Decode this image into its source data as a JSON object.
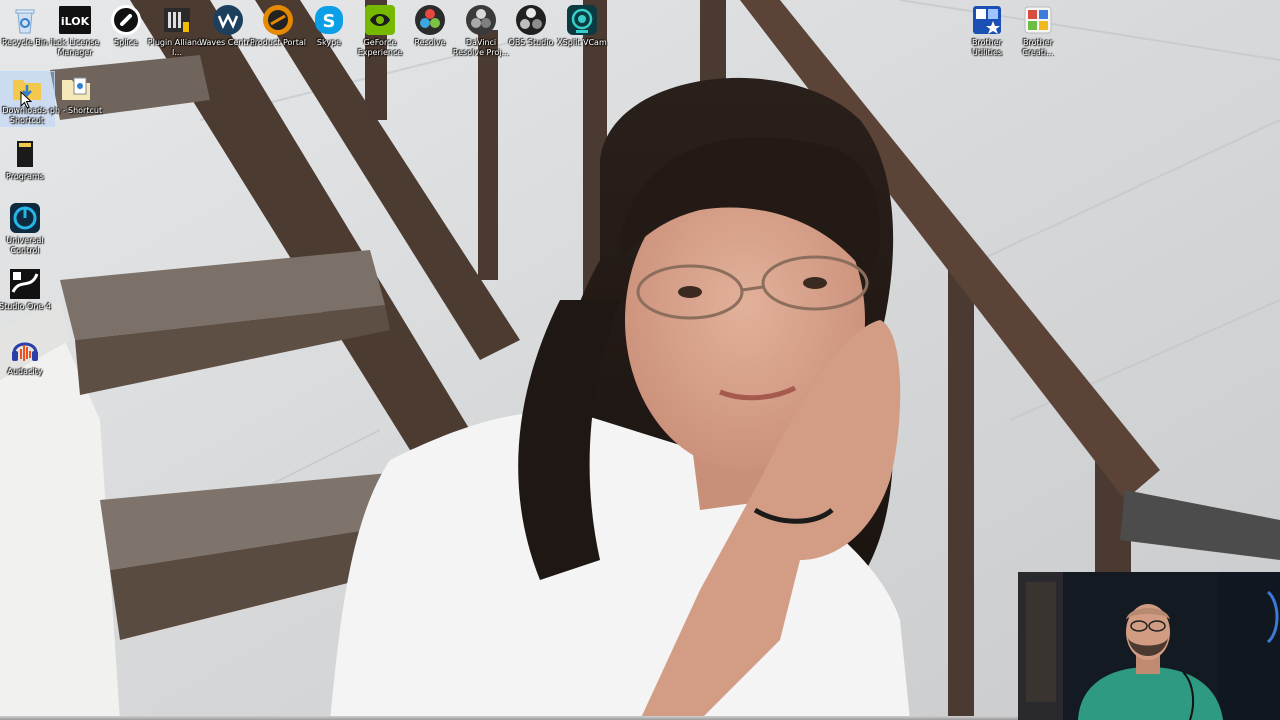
{
  "desktop": {
    "top_icons": [
      {
        "label": "Recycle Bin",
        "icon": "recycle-bin-icon",
        "color": "#9fc3e8"
      },
      {
        "label": "iLok License Manager",
        "icon": "ilok-icon",
        "color": "#111111"
      },
      {
        "label": "Splice",
        "icon": "splice-icon",
        "color": "#ffffff"
      },
      {
        "label": "Plugin Alliance I...",
        "icon": "plugin-alliance-icon",
        "color": "#2a2a2a"
      },
      {
        "label": "Waves Central",
        "icon": "waves-icon",
        "color": "#1c3f5e"
      },
      {
        "label": "Product Portal",
        "icon": "product-portal-icon",
        "color": "#e58a00"
      },
      {
        "label": "Skype",
        "icon": "skype-icon",
        "color": "#0a9fe6"
      },
      {
        "label": "GeForce Experience",
        "icon": "geforce-icon",
        "color": "#76b900"
      },
      {
        "label": "Resolve",
        "icon": "resolve-icon",
        "color": "#2b2b2b"
      },
      {
        "label": "DaVinci Resolve Proj...",
        "icon": "davinci-project-icon",
        "color": "#3a3a3a"
      },
      {
        "label": "OBS Studio",
        "icon": "obs-icon",
        "color": "#202020"
      },
      {
        "label": "XSplit VCam",
        "icon": "xsplit-vcam-icon",
        "color": "#0b6b73"
      }
    ],
    "right_icons": [
      {
        "label": "Brother Utilities",
        "icon": "brother-utilities-icon",
        "color": "#1a4fb3"
      },
      {
        "label": "Brother Creati...",
        "icon": "brother-creative-icon",
        "color": "#d94b3c"
      }
    ],
    "left_icons": [
      {
        "label": "Downloads - Shortcut",
        "icon": "downloads-folder-icon",
        "color": "#f2c94c",
        "selected": true
      },
      {
        "label": "ph - Shortcut",
        "icon": "document-shortcut-icon",
        "color": "#f4e7b8",
        "selected": false
      },
      {
        "label": "Programs",
        "icon": "programs-folder-icon",
        "color": "#1a1a1a",
        "selected": false
      },
      {
        "label": "Universal Control",
        "icon": "universal-control-icon",
        "color": "#0d5e87",
        "selected": false
      },
      {
        "label": "Studio One 4",
        "icon": "studio-one-icon",
        "color": "#111111",
        "selected": false
      },
      {
        "label": "Audacity",
        "icon": "audacity-icon",
        "color": "#f0a81c",
        "selected": false
      }
    ]
  },
  "wallpaper": {
    "subject": "photo-wallpaper",
    "ground_color": "#dcdcdc",
    "rail_color": "#5a4436"
  },
  "webcam_overlay": {
    "background": "#141a22",
    "shirt_color": "#2e9a82"
  }
}
